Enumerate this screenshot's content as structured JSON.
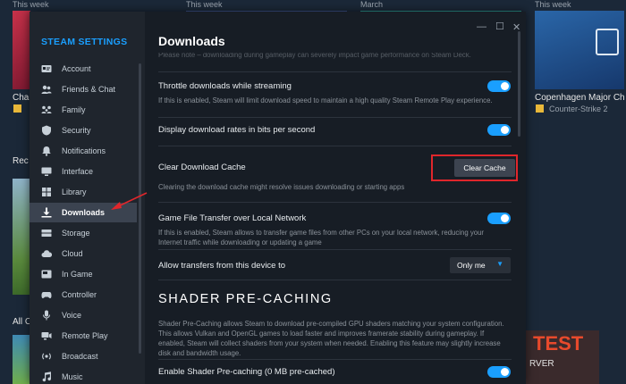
{
  "background": {
    "labels": [
      "This week",
      "This week",
      "March",
      "This week"
    ],
    "captions": [
      "Cha",
      "Copenhagen Major Ch"
    ],
    "game_sub": "Counter-Strike 2",
    "sections": [
      "Rec",
      "All C"
    ],
    "tile_texts": [
      "TEST",
      "RVER"
    ]
  },
  "window": {
    "controls": [
      "—",
      "☐",
      "✕"
    ]
  },
  "sidebar": {
    "title": "STEAM SETTINGS",
    "items": [
      {
        "label": "Account",
        "icon": "account-card-icon"
      },
      {
        "label": "Friends & Chat",
        "icon": "friends-icon"
      },
      {
        "label": "Family",
        "icon": "family-icon"
      },
      {
        "label": "Security",
        "icon": "shield-icon"
      },
      {
        "label": "Notifications",
        "icon": "bell-icon"
      },
      {
        "label": "Interface",
        "icon": "monitor-icon"
      },
      {
        "label": "Library",
        "icon": "grid-icon"
      },
      {
        "label": "Downloads",
        "icon": "download-icon",
        "active": true
      },
      {
        "label": "Storage",
        "icon": "storage-icon"
      },
      {
        "label": "Cloud",
        "icon": "cloud-icon"
      },
      {
        "label": "In Game",
        "icon": "ingame-icon"
      },
      {
        "label": "Controller",
        "icon": "controller-icon"
      },
      {
        "label": "Voice",
        "icon": "microphone-icon"
      },
      {
        "label": "Remote Play",
        "icon": "remote-play-icon"
      },
      {
        "label": "Broadcast",
        "icon": "broadcast-icon"
      },
      {
        "label": "Music",
        "icon": "music-icon"
      }
    ]
  },
  "content": {
    "heading": "Downloads",
    "partial_top": "Please note – downloading during gameplay can severely impact game performance on Steam Deck.",
    "throttle": {
      "title": "Throttle downloads while streaming",
      "desc": "If this is enabled, Steam will limit download speed to maintain a high quality Steam Remote Play experience.",
      "on": true
    },
    "bits": {
      "title": "Display download rates in bits per second",
      "on": true
    },
    "cache": {
      "title": "Clear Download Cache",
      "button": "Clear Cache",
      "desc": "Clearing the download cache might resolve issues downloading or starting apps"
    },
    "transfer": {
      "title": "Game File Transfer over Local Network",
      "desc": "If this is enabled, Steam allows to transfer game files from other PCs on your local network, reducing your Internet traffic while downloading or updating a game",
      "on": true
    },
    "allow": {
      "title": "Allow transfers from this device to",
      "value": "Only me"
    },
    "shader": {
      "heading": "SHADER PRE-CACHING",
      "desc": "Shader Pre-Caching allows Steam to download pre-compiled GPU shaders matching your system configuration. This allows Vulkan and OpenGL games to load faster and improves framerate stability during gameplay. If enabled, Steam will collect shaders from your system when needed. Enabling this feature may slightly increase disk and bandwidth usage.",
      "enable_title": "Enable Shader Pre-caching (0 MB pre-cached)",
      "on": true
    }
  },
  "colors": {
    "accent": "#1a9fff",
    "highlight": "#e0262b",
    "window_bg": "#171d25",
    "sidebar_bg": "#1f252d"
  }
}
